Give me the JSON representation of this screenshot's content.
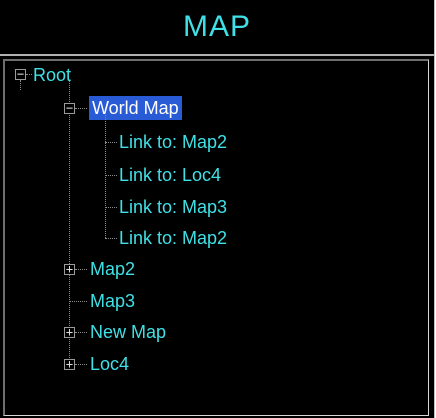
{
  "window": {
    "title": "MAP"
  },
  "tree": {
    "root": {
      "label": "Root",
      "expanded": true
    },
    "world_map": {
      "label": "World Map",
      "expanded": true,
      "selected": true,
      "children": [
        "Link to: Map2",
        "Link to: Loc4",
        "Link to: Map3",
        "Link to: Map2"
      ]
    },
    "nodes": [
      {
        "label": "Map2",
        "expandable": true
      },
      {
        "label": "Map3",
        "expandable": false
      },
      {
        "label": "New Map",
        "expandable": true
      },
      {
        "label": "Loc4",
        "expandable": true
      }
    ]
  },
  "icons": {
    "expanded": "minus-box-icon",
    "collapsed": "plus-box-icon"
  },
  "colors": {
    "background": "#000000",
    "text": "#3fe0e6",
    "selection": "#2a5bd7",
    "connector": "#8a8a8a"
  }
}
